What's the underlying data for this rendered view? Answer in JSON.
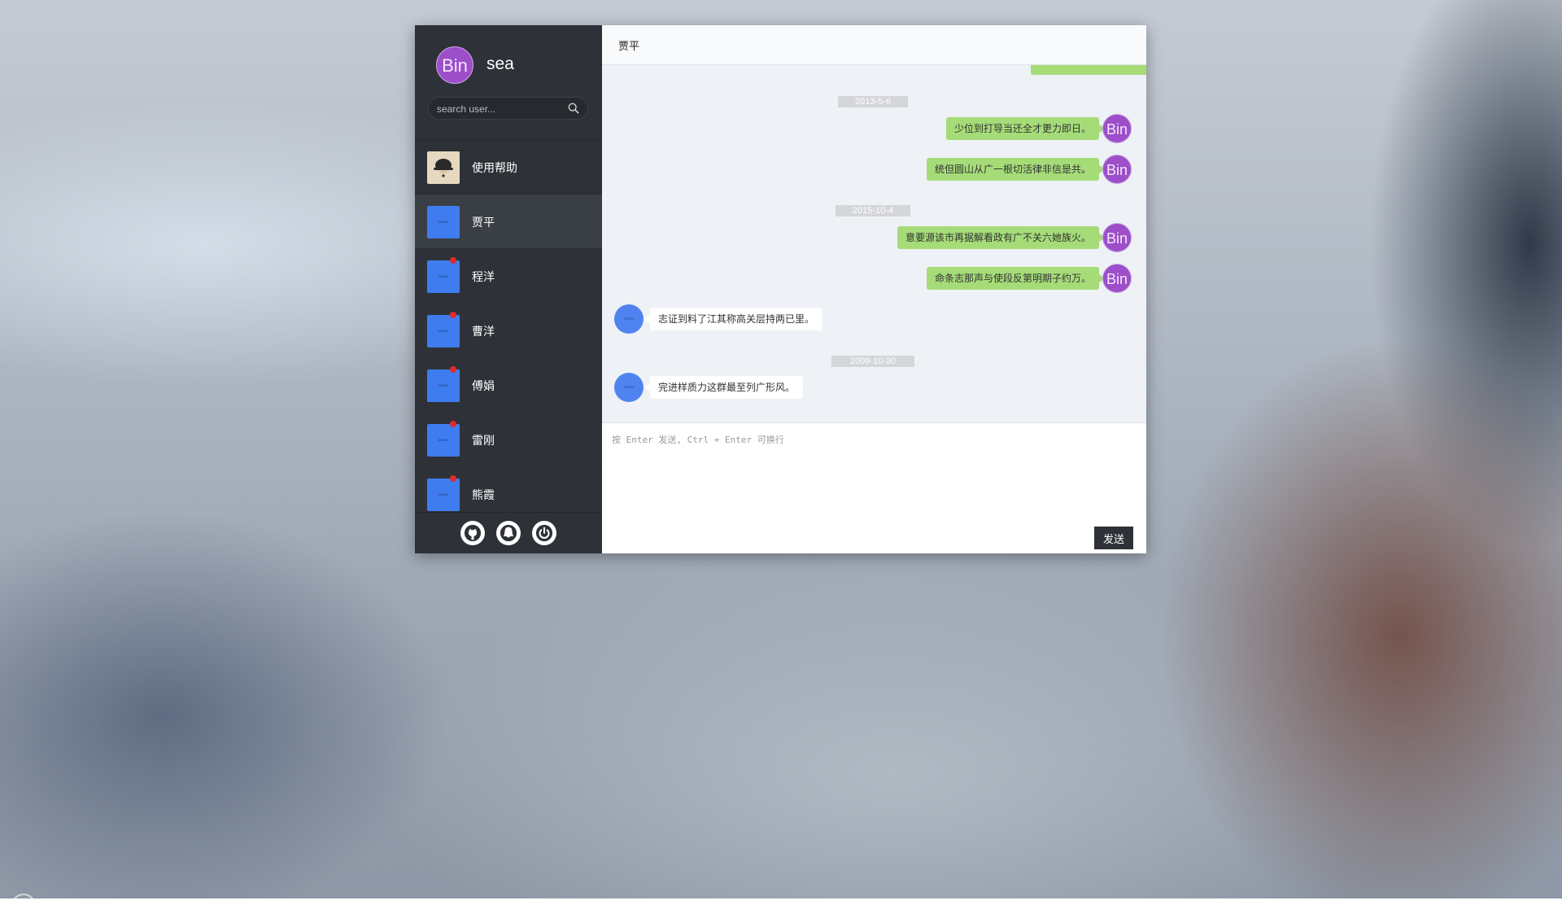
{
  "user": {
    "avatar_text": "Bin",
    "name": "sea"
  },
  "search": {
    "placeholder": "search user..."
  },
  "contacts": [
    {
      "name": "使用帮助",
      "unread": false,
      "active": false
    },
    {
      "name": "贾平",
      "unread": false,
      "active": true,
      "avatar_text": "avatar"
    },
    {
      "name": "程洋",
      "unread": true,
      "active": false,
      "avatar_text": "avatar"
    },
    {
      "name": "曹洋",
      "unread": true,
      "active": false,
      "avatar_text": "avatar"
    },
    {
      "name": "傅娟",
      "unread": true,
      "active": false,
      "avatar_text": "avatar"
    },
    {
      "name": "雷刚",
      "unread": true,
      "active": false,
      "avatar_text": "avatar"
    },
    {
      "name": "熊霞",
      "unread": true,
      "active": false,
      "avatar_text": "avatar"
    }
  ],
  "footer_icons": [
    "github-icon",
    "qq-icon",
    "power-icon"
  ],
  "chat": {
    "title": "贾平",
    "dates": [
      "2013-5-6",
      "2015-10-4",
      "2009-10-30"
    ],
    "messages": [
      {
        "from": "self",
        "text": "少位到打导当还全才更力即日。",
        "avatar": "Bin"
      },
      {
        "from": "self",
        "text": "统但圆山从广一根切活律非信是共。",
        "avatar": "Bin"
      },
      {
        "from": "self",
        "text": "意要源该市再据解看政有广不关六她族火。",
        "avatar": "Bin"
      },
      {
        "from": "self",
        "text": "命条志那声与使段反第明期子约万。",
        "avatar": "Bin"
      },
      {
        "from": "other",
        "text": "志证到料了江其称高关层持两已里。",
        "avatar": "avatar"
      },
      {
        "from": "other",
        "text": "完进样质力这群最至列广形风。",
        "avatar": "avatar"
      }
    ]
  },
  "composer": {
    "placeholder": "按 Enter 发送, Ctrl + Enter 可换行",
    "send_label": "发送"
  },
  "colors": {
    "sidebar": "#2e3238",
    "self_bubble": "#a5dc78",
    "self_avatar": "#9d4ec9",
    "contact_avatar": "#3f7cf0",
    "unread_dot": "#e02b2b"
  }
}
